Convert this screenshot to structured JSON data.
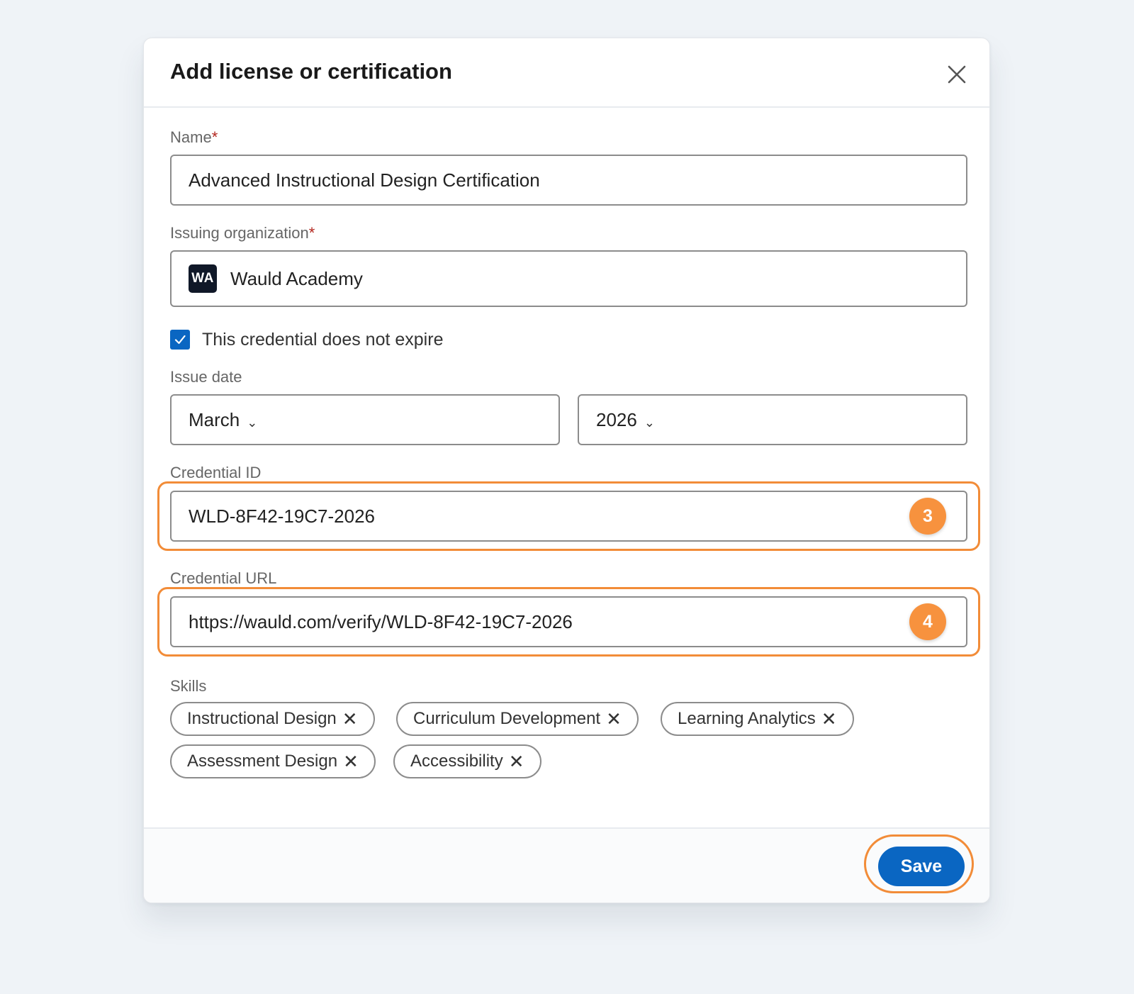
{
  "dialog": {
    "title": "Add license or certification",
    "close_label": "Close"
  },
  "form": {
    "name": {
      "label": "Name",
      "required_mark": "*",
      "value": "Advanced Instructional Design Certification"
    },
    "organization": {
      "label": "Issuing organization",
      "required_mark": "*",
      "logo_text": "WA",
      "value": "Wauld Academy"
    },
    "no_expire": {
      "label": "This credential does not expire",
      "checked": true
    },
    "issue_date": {
      "label": "Issue date",
      "month": "March",
      "year": "2026"
    },
    "credential_id": {
      "label": "Credential ID",
      "value": "WLD-8F42-19C7-2026",
      "step": "3"
    },
    "credential_url": {
      "label": "Credential URL",
      "value": "https://wauld.com/verify/WLD-8F42-19C7-2026",
      "step": "4"
    },
    "skills": {
      "label": "Skills",
      "items": [
        "Instructional Design",
        "Curriculum Development",
        "Learning Analytics",
        "Assessment Design",
        "Accessibility"
      ]
    }
  },
  "footer": {
    "save_label": "Save"
  },
  "colors": {
    "primary": "#0a66c2",
    "highlight": "#f28c38",
    "badge": "#f7923e",
    "required": "#b3261e"
  }
}
